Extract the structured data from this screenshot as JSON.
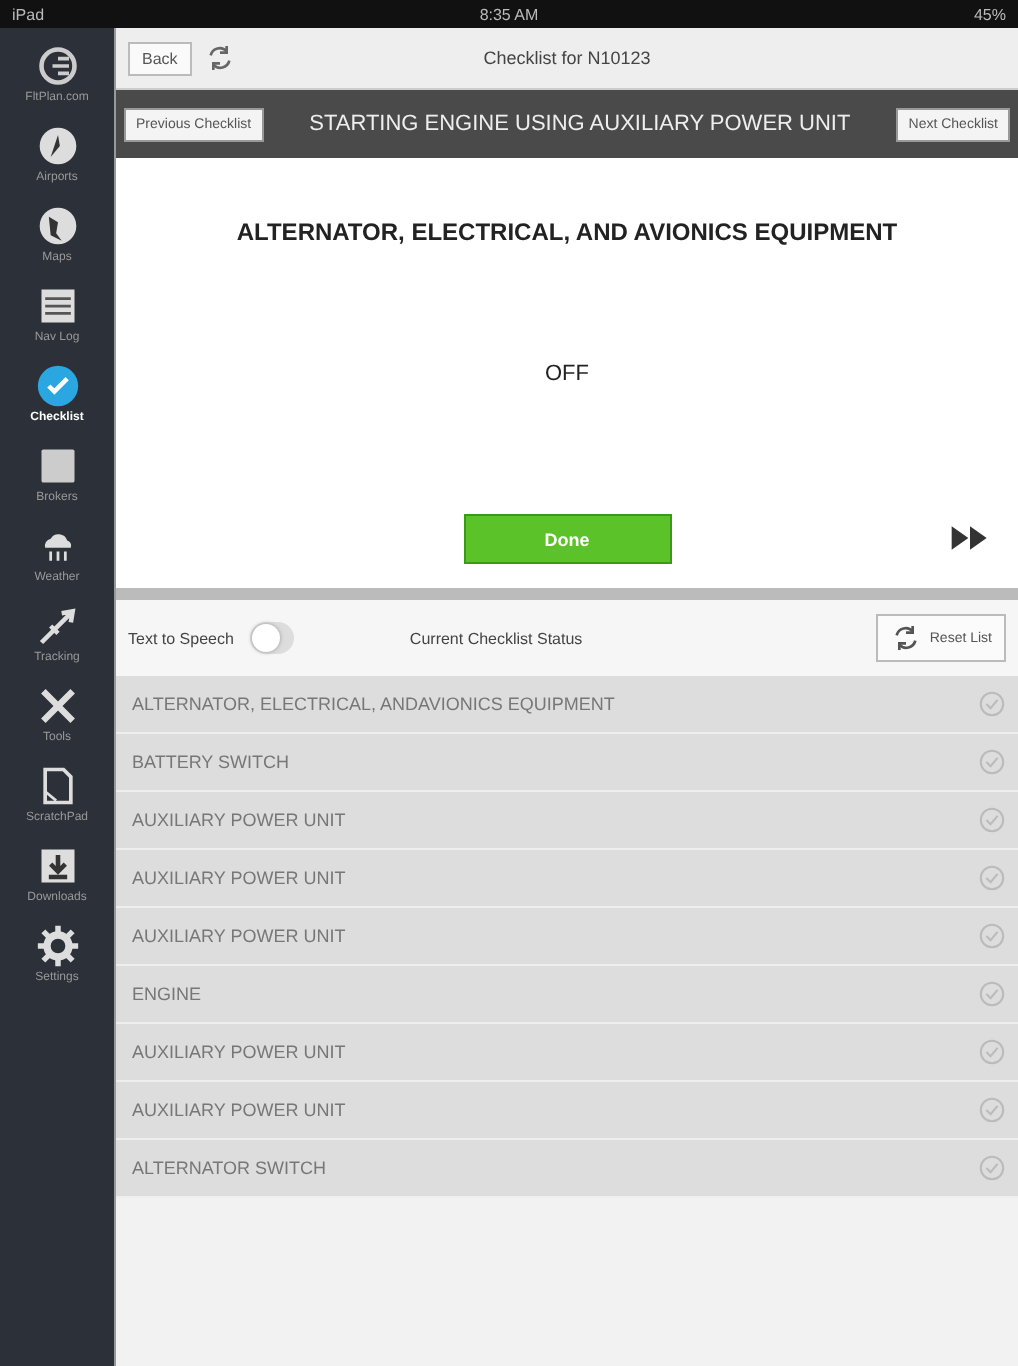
{
  "status_bar": {
    "carrier": "iPad",
    "time": "8:35 AM",
    "battery": "45%"
  },
  "sidebar": {
    "items": [
      {
        "label": "FltPlan.com",
        "selected": false
      },
      {
        "label": "Airports",
        "selected": false
      },
      {
        "label": "Maps",
        "selected": false
      },
      {
        "label": "Nav Log",
        "selected": false
      },
      {
        "label": "Checklist",
        "selected": true
      },
      {
        "label": "Brokers",
        "selected": false
      },
      {
        "label": "Weather",
        "selected": false
      },
      {
        "label": "Tracking",
        "selected": false
      },
      {
        "label": "Tools",
        "selected": false
      },
      {
        "label": "ScratchPad",
        "selected": false
      },
      {
        "label": "Downloads",
        "selected": false
      },
      {
        "label": "Settings",
        "selected": false
      }
    ]
  },
  "header": {
    "back": "Back",
    "title": "Checklist for N10123"
  },
  "checklist_bar": {
    "previous": "Previous Checklist",
    "title": "STARTING ENGINE USING AUXILIARY POWER UNIT",
    "next": "Next Checklist"
  },
  "current_step": {
    "item": "ALTERNATOR, ELECTRICAL, AND AVIONICS EQUIPMENT",
    "action": "OFF",
    "done": "Done"
  },
  "toolbar": {
    "text_to_speech": "Text to Speech",
    "speech_on": false,
    "status": "Current Checklist Status",
    "reset": "Reset List"
  },
  "items": [
    {
      "label": "ALTERNATOR, ELECTRICAL, ANDAVIONICS EQUIPMENT",
      "checked": false
    },
    {
      "label": "BATTERY SWITCH",
      "checked": false
    },
    {
      "label": "AUXILIARY POWER UNIT",
      "checked": false
    },
    {
      "label": "AUXILIARY POWER UNIT",
      "checked": false
    },
    {
      "label": "AUXILIARY POWER UNIT",
      "checked": false
    },
    {
      "label": "ENGINE",
      "checked": false
    },
    {
      "label": "AUXILIARY POWER UNIT",
      "checked": false
    },
    {
      "label": "AUXILIARY POWER UNIT",
      "checked": false
    },
    {
      "label": "ALTERNATOR SWITCH",
      "checked": false
    }
  ]
}
